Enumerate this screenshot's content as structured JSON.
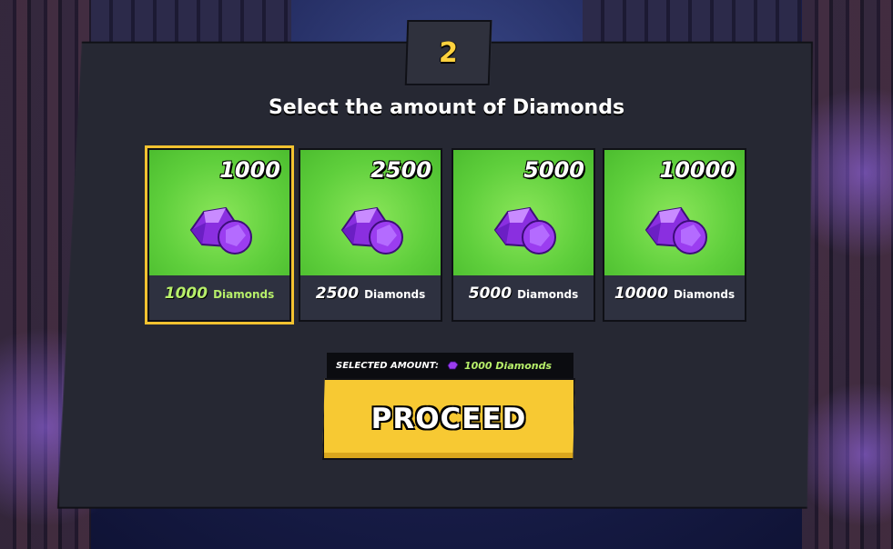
{
  "step": {
    "number": "2"
  },
  "title": "Select the amount of Diamonds",
  "packages": [
    {
      "amount": "1000",
      "number": "1000",
      "unit": "Diamonds",
      "selected": true
    },
    {
      "amount": "2500",
      "number": "2500",
      "unit": "Diamonds",
      "selected": false
    },
    {
      "amount": "5000",
      "number": "5000",
      "unit": "Diamonds",
      "selected": false
    },
    {
      "amount": "10000",
      "number": "10000",
      "unit": "Diamonds",
      "selected": false
    }
  ],
  "selection": {
    "label": "SELECTED AMOUNT:",
    "value": "1000 Diamonds",
    "icon": "diamond-icon"
  },
  "proceed_label": "PROCEED",
  "colors": {
    "accent_yellow": "#f7c933",
    "card_green": "#5fcf3c",
    "selected_text_green": "#b7ef6a",
    "panel_bg": "#262833",
    "gem_purple": "#9b3df0"
  }
}
